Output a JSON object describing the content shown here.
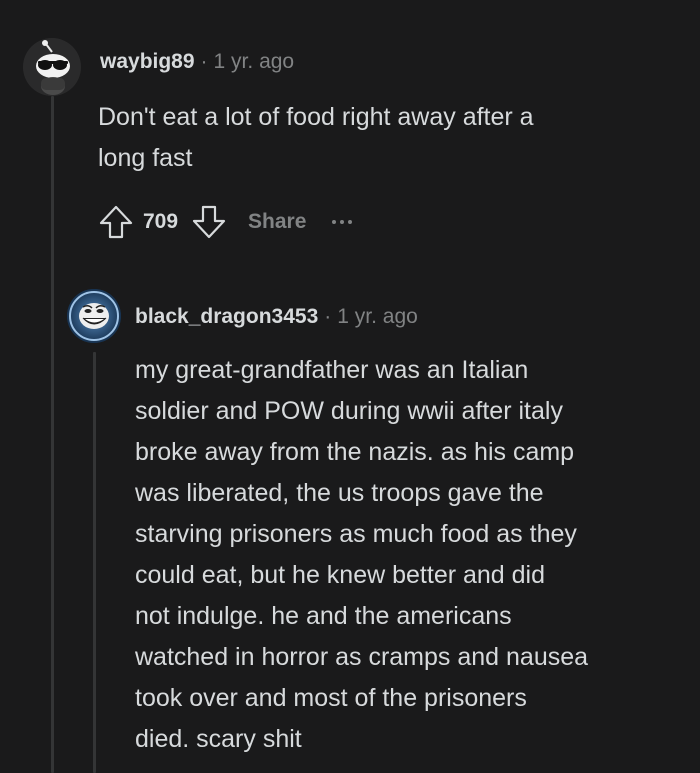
{
  "comments": [
    {
      "username": "waybig89",
      "separator": "·",
      "time": "1 yr. ago",
      "body_lines": [
        "Don't eat a lot of food right away after a",
        "long fast"
      ],
      "score": "709",
      "share_label": "Share",
      "avatar_icon": "sunglasses-snoo-avatar-icon"
    },
    {
      "username": "black_dragon3453",
      "separator": "·",
      "time": "1 yr. ago",
      "body_lines": [
        "my great-grandfather was an Italian",
        "soldier and POW during wwii after italy",
        "broke away from the nazis. as his camp",
        "was liberated, the us troops gave the",
        "starving prisoners as much food as they",
        "could eat, but he knew better and did",
        "not indulge. he and the americans",
        "watched in horror as cramps and nausea",
        "took over and most of the prisoners",
        "died. scary shit"
      ],
      "avatar_icon": "trollface-avatar-icon"
    }
  ],
  "colors": {
    "background": "#1a1a1b",
    "text": "#d7dadc",
    "muted": "#818384",
    "thread_line": "#343536"
  }
}
